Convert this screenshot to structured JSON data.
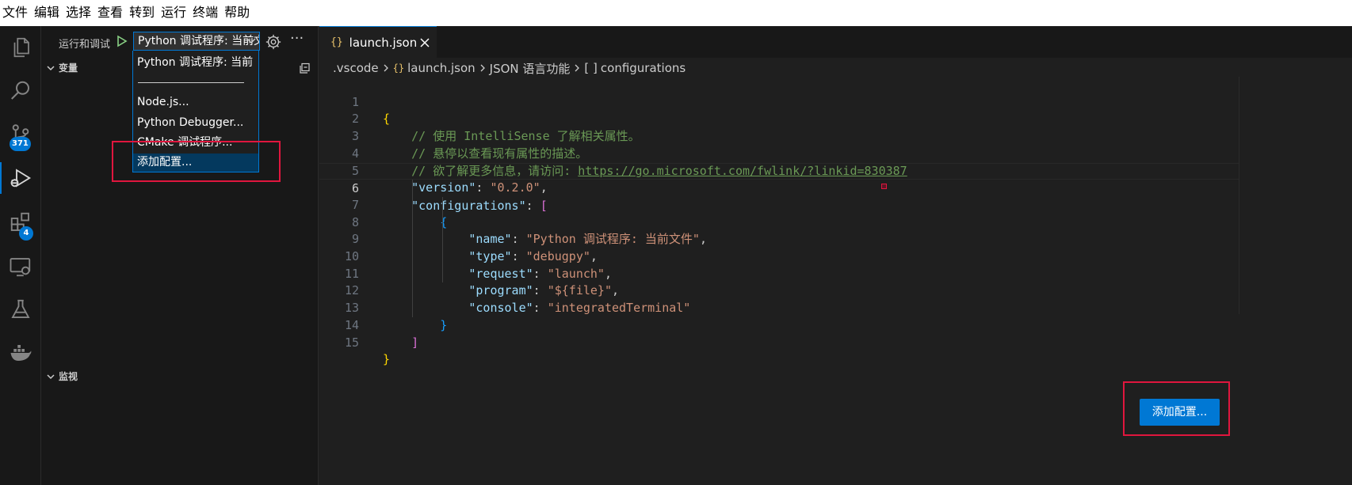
{
  "menubar": {
    "items": [
      "文件",
      "编辑",
      "选择",
      "查看",
      "转到",
      "运行",
      "终端",
      "帮助"
    ]
  },
  "activity_bar": {
    "source_control_badge": "371",
    "extensions_badge": "4",
    "icons": [
      "files-icon",
      "search-icon",
      "source-control-icon",
      "run-debug-icon",
      "extensions-icon",
      "remote-explorer-icon",
      "testing-icon",
      "docker-icon"
    ]
  },
  "sidebar": {
    "title": "运行和调试",
    "selected_config": "Python 调试程序: 当前文件",
    "more": "···",
    "sections": {
      "variables": "变量",
      "watch": "监视"
    }
  },
  "dropdown": {
    "items": [
      "Python 调试程序: 当前",
      "Node.js...",
      "Python Debugger...",
      "CMake 调试程序...",
      "添加配置..."
    ],
    "selected_index": 4
  },
  "editor": {
    "tab_icon": "{}",
    "tab_label": "launch.json",
    "breadcrumb": [
      ".vscode",
      "launch.json",
      "JSON 语言功能",
      "configurations"
    ],
    "breadcrumb_icons": [
      "{}",
      "[ ]"
    ],
    "line_numbers": [
      "1",
      "2",
      "3",
      "4",
      "5",
      "6",
      "7",
      "8",
      "9",
      "10",
      "11",
      "12",
      "13",
      "14",
      "15"
    ],
    "current_line": 6,
    "comments": [
      "// 使用 IntelliSense 了解相关属性。",
      "// 悬停以查看现有属性的描述。",
      "// 欲了解更多信息，请访问: "
    ],
    "link": "https://go.microsoft.com/fwlink/?linkid=830387",
    "keys": {
      "version": "\"version\"",
      "configurations": "\"configurations\"",
      "name": "\"name\"",
      "type": "\"type\"",
      "request": "\"request\"",
      "program": "\"program\"",
      "console": "\"console\""
    },
    "values": {
      "version": "\"0.2.0\"",
      "name": "\"Python 调试程序: 当前文件\"",
      "type": "\"debugpy\"",
      "request": "\"launch\"",
      "program": "\"${file}\"",
      "console": "\"integratedTerminal\""
    },
    "add_config_button": "添加配置..."
  },
  "colors": {
    "accent": "#0078d4",
    "highlight_box": "#e0163e"
  }
}
